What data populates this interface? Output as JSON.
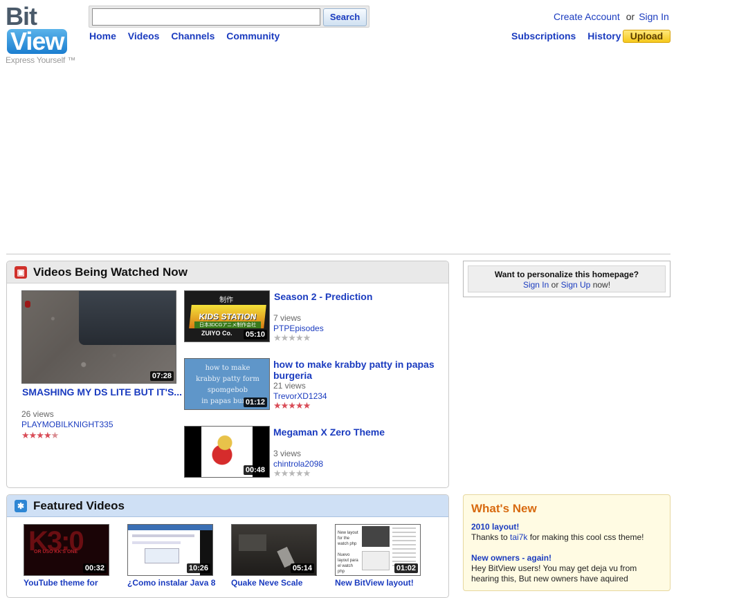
{
  "brand": {
    "word_left": "Bit",
    "word_right": "View",
    "tagline": "Express Yourself ™"
  },
  "search": {
    "value": "",
    "placeholder": "",
    "button": "Search"
  },
  "nav": [
    "Home",
    "Videos",
    "Channels",
    "Community"
  ],
  "account": {
    "create": "Create Account",
    "or": "or",
    "sign_in": "Sign In"
  },
  "right_nav": {
    "subscriptions": "Subscriptions",
    "history": "History",
    "upload": "Upload"
  },
  "watched_now": {
    "title": "Videos Being Watched Now",
    "main": {
      "title": "SMASHING MY DS LITE BUT IT'S...",
      "duration": "07:28",
      "views": "26 views",
      "user": "PLAYMOBILKNIGHT335",
      "rating": 4.5
    },
    "list": [
      {
        "title": "Season 2 - Prediction",
        "duration": "05:10",
        "views": "7 views",
        "user": "PTPEpisodes",
        "rating": 0
      },
      {
        "title_line1": "how to make krabby patty in papas",
        "title_line2": "burgeria",
        "duration": "01:12",
        "views": "21 views",
        "user": "TrevorXD1234",
        "rating": 5
      },
      {
        "title": "Megaman X Zero Theme",
        "duration": "00:48",
        "views": "3 views",
        "user": "chintrola2098",
        "rating": 0
      }
    ]
  },
  "thumb_text": {
    "kids_top": "制作",
    "kids_logo": "KIDS STATION",
    "kids_sub": "日本3DCGアニメ制作会社",
    "kids_bottom": "ZUIYO Co.",
    "krabby": [
      "how to make",
      "krabby patty form",
      "spomgebob",
      "in papas burge"
    ],
    "yt_big": "K3:0",
    "yt_small": "OR USO KK'S ONE",
    "nl_label1": "New layout for the watch php",
    "nl_label2": "Nuevo layout para el watch php"
  },
  "personalize": {
    "question": "Want to personalize this homepage?",
    "sign_in": "Sign In",
    "or": "or",
    "sign_up": "Sign Up",
    "tail": "now!"
  },
  "featured": {
    "title": "Featured Videos",
    "items": [
      {
        "title": "YouTube theme for",
        "duration": "00:32"
      },
      {
        "title": "¿Como instalar Java 8",
        "duration": "10:26"
      },
      {
        "title": "Quake Neve Scale",
        "duration": "05:14"
      },
      {
        "title": "New BitView layout!",
        "duration": "01:02"
      }
    ]
  },
  "whats_new": {
    "title": "What's New",
    "items": [
      {
        "title": "2010 layout!",
        "body_prefix": "Thanks to ",
        "body_link": "tai7k",
        "body_suffix": " for making this cool css theme!"
      },
      {
        "title": "New owners - again!",
        "body": "Hey BitView users! You may get deja vu from hearing this, But new owners have aquired"
      }
    ]
  },
  "colors": {
    "link": "#1a3bbf",
    "accent_orange": "#d86a10",
    "upload_yellow": "#f5c81c",
    "star_red": "#d94c57"
  }
}
